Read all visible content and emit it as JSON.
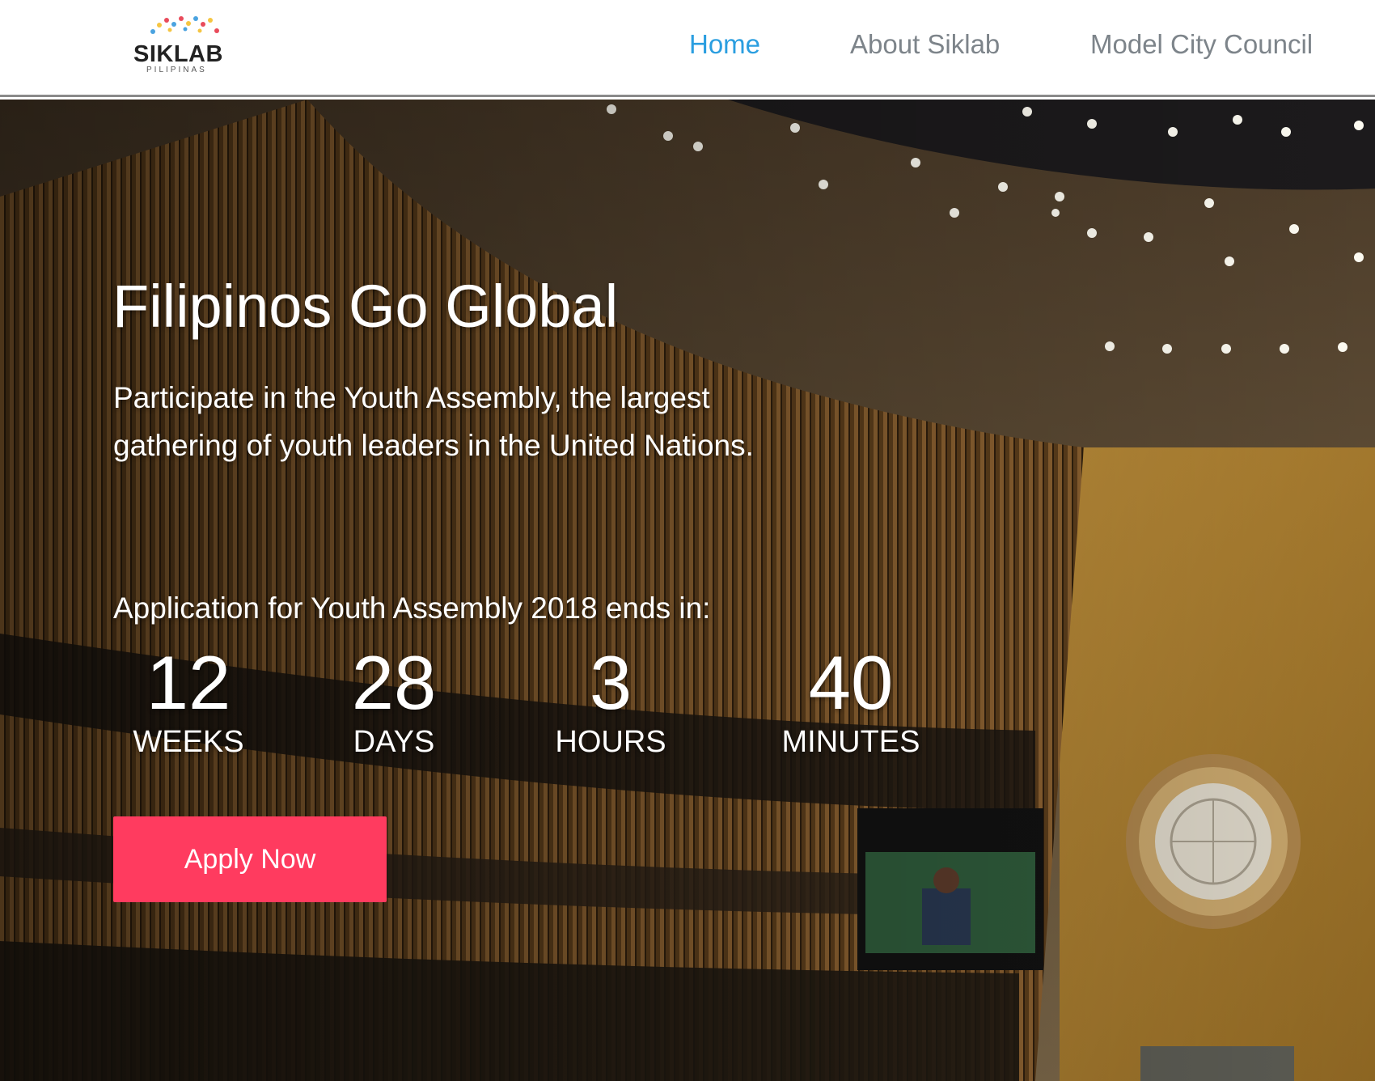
{
  "header": {
    "logo": {
      "name": "SIKLAB",
      "tagline": "PILIPINAS"
    },
    "nav": [
      {
        "label": "Home",
        "active": true
      },
      {
        "label": "About Siklab",
        "active": false
      },
      {
        "label": "Model City Council",
        "active": false
      }
    ]
  },
  "hero": {
    "title": "Filipinos Go Global",
    "subtitle": "Participate in the Youth Assembly, the largest gathering of youth leaders in the United Nations.",
    "countdown": {
      "label": "Application for Youth Assembly 2018 ends in:",
      "units": [
        {
          "value": "12",
          "label": "WEEKS"
        },
        {
          "value": "28",
          "label": "DAYS"
        },
        {
          "value": "3",
          "label": "HOURS"
        },
        {
          "value": "40",
          "label": "MINUTES"
        }
      ]
    },
    "cta_label": "Apply Now"
  },
  "colors": {
    "nav_active": "#2a9ee0",
    "nav_inactive": "#7d848a",
    "cta_background": "#ff3b5f",
    "hero_text": "#ffffff"
  }
}
